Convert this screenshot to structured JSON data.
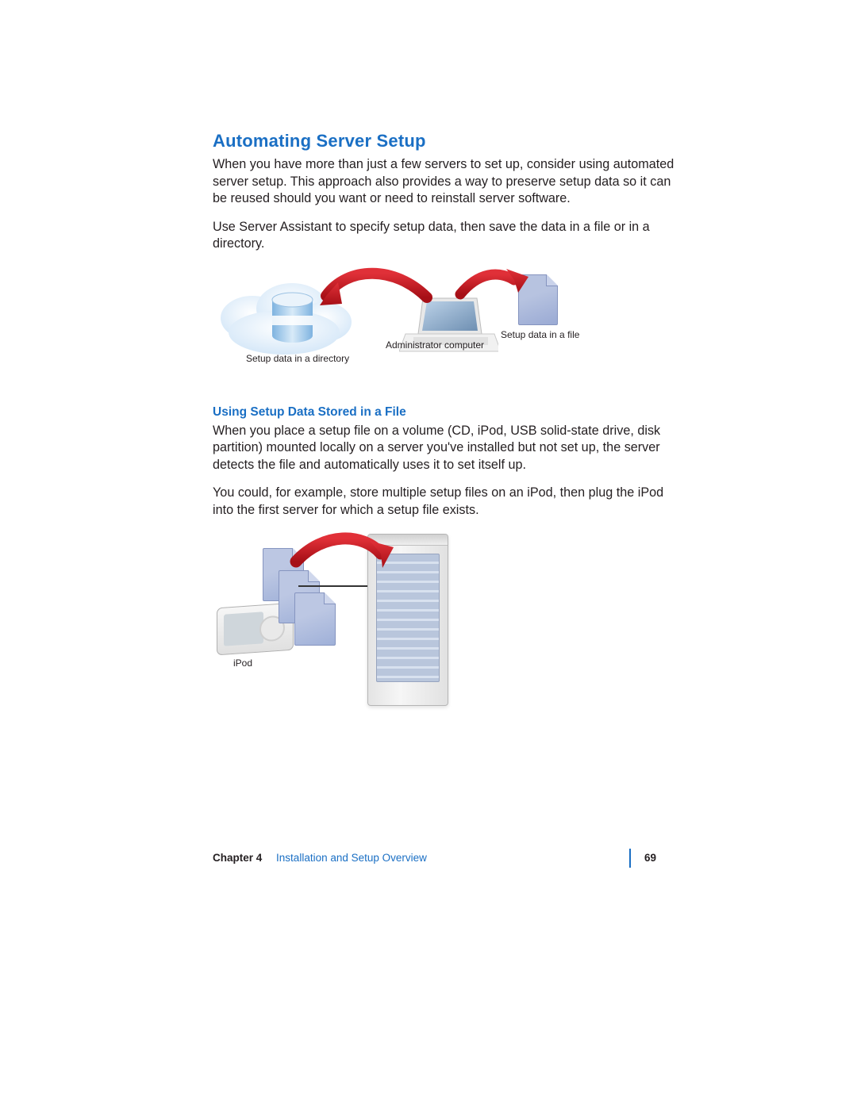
{
  "headings": {
    "h2": "Automating Server Setup",
    "h3": "Using Setup Data Stored in a File"
  },
  "paragraphs": {
    "p1": "When you have more than just a few servers to set up, consider using automated server setup. This approach also provides a way to preserve setup data so it can be reused should you want or need to reinstall server software.",
    "p2": "Use Server Assistant to specify setup data, then save the data in a file or in a directory.",
    "p3": "When you place a setup file on a volume (CD, iPod, USB solid-state drive, disk partition) mounted locally on a server you've installed but not set up, the server detects the file and automatically uses it to set itself up.",
    "p4": "You could, for example, store multiple setup files on an iPod, then plug the iPod into the first server for which a setup file exists."
  },
  "figure1_labels": {
    "setup_directory": "Setup data in a directory",
    "admin_computer": "Administrator computer",
    "setup_file": "Setup data in a file"
  },
  "figure2_labels": {
    "ipod": "iPod"
  },
  "footer": {
    "chapter": "Chapter 4",
    "title": "Installation and Setup Overview",
    "page": "69"
  },
  "colors": {
    "accent": "#1a6fc4",
    "arrow": "#cf1820"
  }
}
